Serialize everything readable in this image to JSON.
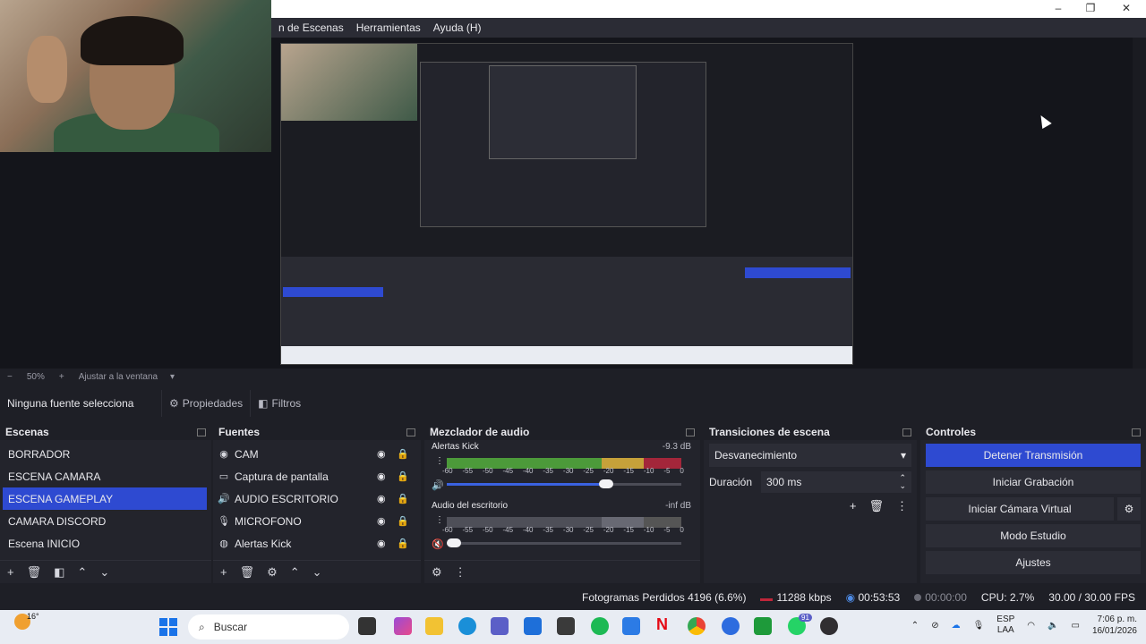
{
  "titlebar": {
    "minimize": "–",
    "maximize": "❐",
    "close": "✕"
  },
  "menu": [
    "n de Escenas",
    "Herramientas",
    "Ayuda (H)"
  ],
  "zoom": {
    "minus": "−",
    "value": "50%",
    "plus": "+",
    "fit": "Ajustar a la ventana"
  },
  "sourcebar": {
    "nosel": "Ninguna fuente selecciona",
    "properties": "Propiedades",
    "filters": "Filtros"
  },
  "scenes": {
    "title": "Escenas",
    "items": [
      "BORRADOR",
      "ESCENA CAMARA",
      "ESCENA GAMEPLAY",
      "CAMARA DISCORD",
      "Escena INICIO"
    ],
    "selected_index": 2
  },
  "sources": {
    "title": "Fuentes",
    "items": [
      {
        "icon": "camera-icon",
        "label": "CAM"
      },
      {
        "icon": "monitor-icon",
        "label": "Captura de pantalla"
      },
      {
        "icon": "speaker-icon",
        "label": "AUDIO ESCRITORIO"
      },
      {
        "icon": "microphone-icon",
        "label": "MICROFONO"
      },
      {
        "icon": "browser-icon",
        "label": "Alertas Kick"
      }
    ]
  },
  "mixer": {
    "title": "Mezclador de audio",
    "scale": [
      "-60",
      "-55",
      "-50",
      "-45",
      "-40",
      "-35",
      "-30",
      "-25",
      "-20",
      "-15",
      "-10",
      "-5",
      "0"
    ],
    "channels": [
      {
        "name": "Alertas Kick",
        "db": "-9.3 dB",
        "level": 0.86,
        "volume": 0.68,
        "active": true
      },
      {
        "name": "Audio del escritorio",
        "db": "-inf dB",
        "level": 0.0,
        "volume": 0.0,
        "active": false
      }
    ]
  },
  "transitions": {
    "title": "Transiciones de escena",
    "selected": "Desvanecimiento",
    "duration_label": "Duración",
    "duration_value": "300 ms"
  },
  "controls": {
    "title": "Controles",
    "buttons": [
      "Detener Transmisión",
      "Iniciar Grabación",
      "Iniciar Cámara Virtual",
      "Modo Estudio",
      "Ajustes"
    ]
  },
  "status": {
    "dropped": "Fotogramas Perdidos 4196 (6.6%)",
    "bitrate": "11288 kbps",
    "stream_time": "00:53:53",
    "rec_time": "00:00:00",
    "cpu": "CPU: 2.7%",
    "fps": "30.00 / 30.00 FPS"
  },
  "taskbar": {
    "weather": "16°",
    "search": "Buscar",
    "lang": "ESP",
    "lang2": "LAA",
    "time": "7:06 p. m.",
    "date": "16/01/2026",
    "badge": "91"
  },
  "colors": {
    "accent": "#2e4ad1",
    "bg": "#1e1f26",
    "panel": "#23242c"
  }
}
